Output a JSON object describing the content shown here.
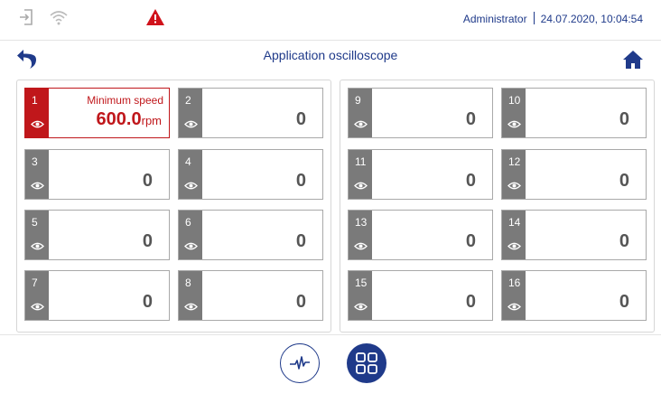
{
  "header": {
    "user": "Administrator",
    "datetime": "24.07.2020, 10:04:54",
    "alert_color": "#d0121b"
  },
  "title_bar": {
    "title": "Application oscilloscope"
  },
  "channels": [
    {
      "number": "1",
      "label": "Minimum speed",
      "value": "600.0",
      "unit": "rpm",
      "active": true
    },
    {
      "number": "2",
      "value": "0"
    },
    {
      "number": "3",
      "value": "0"
    },
    {
      "number": "4",
      "value": "0"
    },
    {
      "number": "5",
      "value": "0"
    },
    {
      "number": "6",
      "value": "0"
    },
    {
      "number": "7",
      "value": "0"
    },
    {
      "number": "8",
      "value": "0"
    },
    {
      "number": "9",
      "value": "0"
    },
    {
      "number": "10",
      "value": "0"
    },
    {
      "number": "11",
      "value": "0"
    },
    {
      "number": "12",
      "value": "0"
    },
    {
      "number": "13",
      "value": "0"
    },
    {
      "number": "14",
      "value": "0"
    },
    {
      "number": "15",
      "value": "0"
    },
    {
      "number": "16",
      "value": "0"
    }
  ],
  "colors": {
    "accent": "#1f3a8a",
    "active": "#c0171b",
    "inactive_tab": "#7a7a7a"
  },
  "footer": {
    "buttons": [
      {
        "icon": "oscilloscope-wave-icon",
        "selected": false
      },
      {
        "icon": "grid-view-icon",
        "selected": true
      }
    ]
  }
}
